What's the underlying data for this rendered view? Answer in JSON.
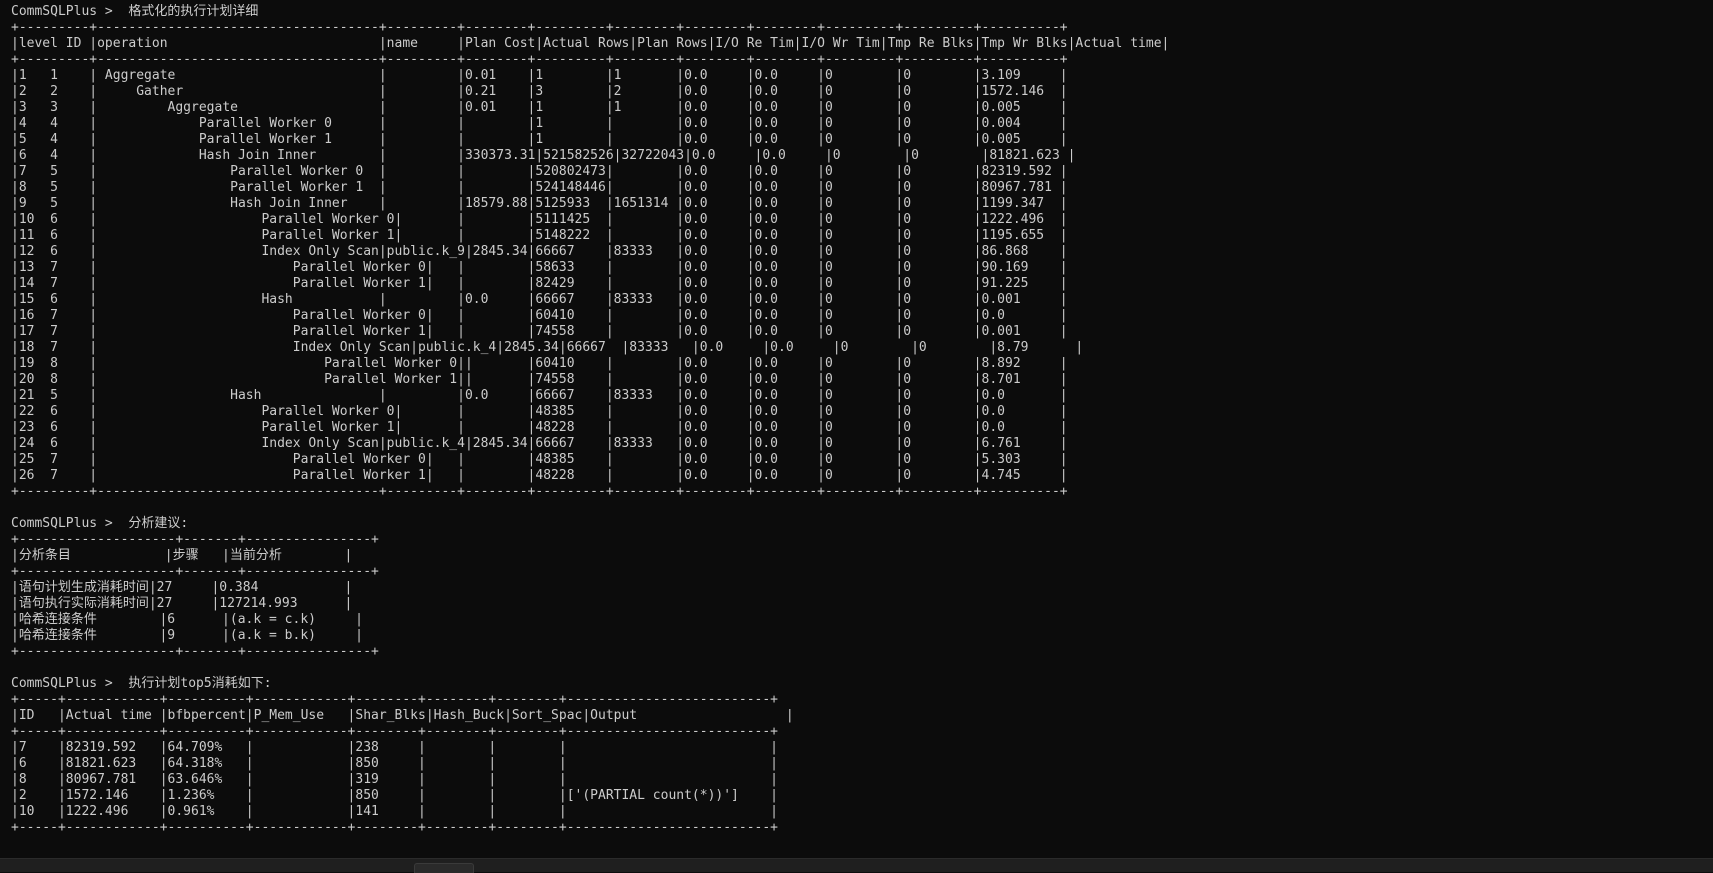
{
  "terminal": {
    "lines": [
      "CommSQLPlus >  格式化的执行计划详细",
      "+---------+------------------------------------+---------+--------+---------+--------+--------+--------+---------+---------+----------+",
      "|level ID |operation                           |name     |Plan Cost|Actual Rows|Plan Rows|I/O Re Tim|I/O Wr Tim|Tmp Re Blks|Tmp Wr Blks|Actual time|",
      "+---------+------------------------------------+---------+--------+---------+--------+--------+--------+---------+---------+----------+",
      "|1   1    | Aggregate                          |         |0.01    |1        |1       |0.0     |0.0     |0        |0        |3.109     |",
      "|2   2    |     Gather                         |         |0.21    |3        |2       |0.0     |0.0     |0        |0        |1572.146  |",
      "|3   3    |         Aggregate                  |         |0.01    |1        |1       |0.0     |0.0     |0        |0        |0.005     |",
      "|4   4    |             Parallel Worker 0      |         |        |1        |        |0.0     |0.0     |0        |0        |0.004     |",
      "|5   4    |             Parallel Worker 1      |         |        |1        |        |0.0     |0.0     |0        |0        |0.005     |",
      "|6   4    |             Hash Join Inner        |         |330373.31|521582526|32722043|0.0     |0.0     |0        |0        |81821.623 |",
      "|7   5    |                 Parallel Worker 0  |         |        |520802473|        |0.0     |0.0     |0        |0        |82319.592 |",
      "|8   5    |                 Parallel Worker 1  |         |        |524148446|        |0.0     |0.0     |0        |0        |80967.781 |",
      "|9   5    |                 Hash Join Inner    |         |18579.88|5125933  |1651314 |0.0     |0.0     |0        |0        |1199.347  |",
      "|10  6    |                     Parallel Worker 0|       |        |5111425  |        |0.0     |0.0     |0        |0        |1222.496  |",
      "|11  6    |                     Parallel Worker 1|       |        |5148222  |        |0.0     |0.0     |0        |0        |1195.655  |",
      "|12  6    |                     Index Only Scan|public.k_9|2845.34|66667    |83333   |0.0     |0.0     |0        |0        |86.868    |",
      "|13  7    |                         Parallel Worker 0|   |        |58633    |        |0.0     |0.0     |0        |0        |90.169    |",
      "|14  7    |                         Parallel Worker 1|   |        |82429    |        |0.0     |0.0     |0        |0        |91.225    |",
      "|15  6    |                     Hash           |         |0.0     |66667    |83333   |0.0     |0.0     |0        |0        |0.001     |",
      "|16  7    |                         Parallel Worker 0|   |        |60410    |        |0.0     |0.0     |0        |0        |0.0       |",
      "|17  7    |                         Parallel Worker 1|   |        |74558    |        |0.0     |0.0     |0        |0        |0.001     |",
      "|18  7    |                         Index Only Scan|public.k_4|2845.34|66667  |83333   |0.0     |0.0     |0        |0        |8.79      |",
      "|19  8    |                             Parallel Worker 0||       |60410    |        |0.0     |0.0     |0        |0        |8.892     |",
      "|20  8    |                             Parallel Worker 1||       |74558    |        |0.0     |0.0     |0        |0        |8.701     |",
      "|21  5    |                 Hash               |         |0.0     |66667    |83333   |0.0     |0.0     |0        |0        |0.0       |",
      "|22  6    |                     Parallel Worker 0|       |        |48385    |        |0.0     |0.0     |0        |0        |0.0       |",
      "|23  6    |                     Parallel Worker 1|       |        |48228    |        |0.0     |0.0     |0        |0        |0.0       |",
      "|24  6    |                     Index Only Scan|public.k_4|2845.34|66667    |83333   |0.0     |0.0     |0        |0        |6.761     |",
      "|25  7    |                         Parallel Worker 0|   |        |48385    |        |0.0     |0.0     |0        |0        |5.303     |",
      "|26  7    |                         Parallel Worker 1|   |        |48228    |        |0.0     |0.0     |0        |0        |4.745     |",
      "+---------+------------------------------------+---------+--------+---------+--------+--------+--------+---------+---------+----------+",
      "",
      "CommSQLPlus >  分析建议:",
      "+--------------------+-------+----------------+",
      "|分析条目            |步骤   |当前分析        |",
      "+--------------------+-------+----------------+",
      "|语句计划生成消耗时间|27     |0.384           |",
      "|语句执行实际消耗时间|27     |127214.993      |",
      "|哈希连接条件        |6      |(a.k = c.k)     |",
      "|哈希连接条件        |9      |(a.k = b.k)     |",
      "+--------------------+-------+----------------+",
      "",
      "CommSQLPlus >  执行计划top5消耗如下:",
      "+-----+------------+----------+------------+--------+--------+--------+--------------------------+",
      "|ID   |Actual time |bfbpercent|P_Mem_Use   |Shar_Blks|Hash_Buck|Sort_Spac|Output                   |",
      "+-----+------------+----------+------------+--------+--------+--------+--------------------------+",
      "|7    |82319.592   |64.709%   |            |238     |        |        |                          |",
      "|6    |81821.623   |64.318%   |            |850     |        |        |                          |",
      "|8    |80967.781   |63.646%   |            |319     |        |        |                          |",
      "|2    |1572.146    |1.236%    |            |850     |        |        |['(PARTIAL count(*))']    |",
      "|10   |1222.496    |0.961%    |            |141     |        |        |                          |",
      "+-----+------------+----------+------------+--------+--------+--------+--------------------------+"
    ]
  }
}
